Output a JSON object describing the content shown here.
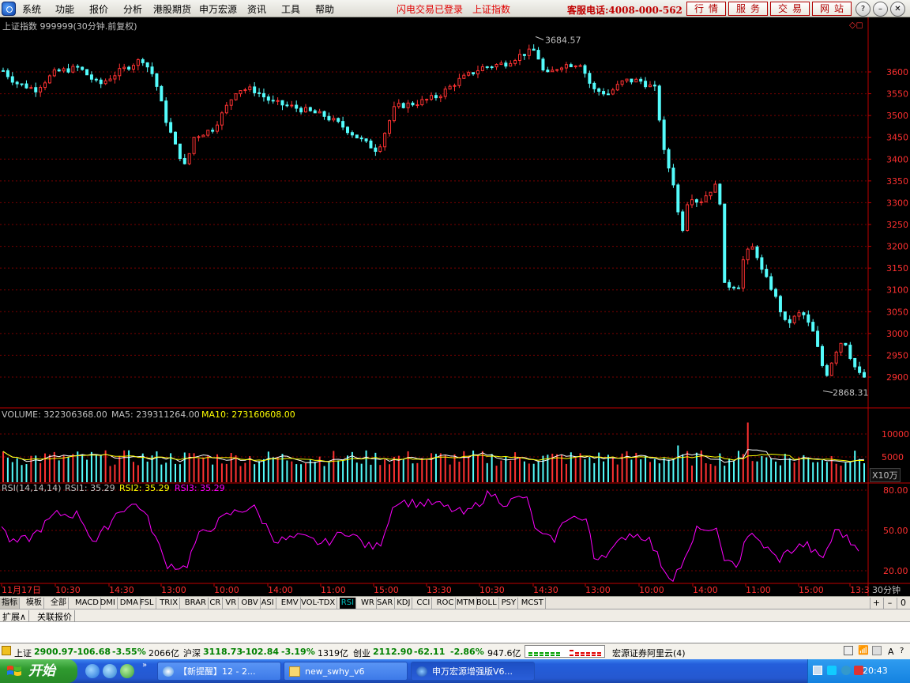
{
  "menu": [
    "系统",
    "功能",
    "报价",
    "分析",
    "港股期货",
    "申万宏源",
    "资讯",
    "工具",
    "帮助"
  ],
  "links": [
    "闪电交易已登录",
    "上证指数"
  ],
  "hotline": "客服电话:4008-000-562",
  "top_buttons": [
    "行情",
    "服务",
    "交易",
    "网站"
  ],
  "window_buttons": {
    "help": "?",
    "minimize": "–",
    "restore": "❐",
    "close": "✕"
  },
  "main_pane": {
    "title": "上证指数 999999(30分钟.前复权)",
    "high_label": "3684.57",
    "low_label": "2868.31",
    "y_ticks": [
      "3600",
      "3550",
      "3500",
      "3450",
      "3400",
      "3350",
      "3300",
      "3250",
      "3200",
      "3150",
      "3100",
      "3050",
      "3000",
      "2950",
      "2900"
    ]
  },
  "volume_pane": {
    "vol_label": "VOLUME: 322306368.00",
    "ma5_label": "MA5: 239311264.00",
    "ma10_label": "MA10: 273160608.00",
    "y_ticks": [
      "10000",
      "5000"
    ],
    "unit": "X10万"
  },
  "rsi_pane": {
    "title": "RSI(14,14,14)",
    "rsi1_label": "RSI1: 35.29",
    "rsi2_label": "RSI2: 35.29",
    "rsi3_label": "RSI3: 35.29",
    "y_ticks": [
      "80.00",
      "50.00",
      "20.00"
    ]
  },
  "time_axis": [
    "11月17日",
    "10:30",
    "14:30",
    "13:00",
    "10:00",
    "14:00",
    "11:00",
    "15:00",
    "13:30",
    "10:30",
    "14:30",
    "13:00",
    "10:00",
    "14:00",
    "11:00",
    "15:00",
    "13:3"
  ],
  "period": "30分钟",
  "indicator_tabs": [
    "指标",
    "模板",
    "全部",
    "MACD",
    "DMI",
    "DMA",
    "FSL",
    "TRIX",
    "BRAR",
    "CR",
    "VR",
    "OBV",
    "ASI",
    "EMV",
    "VOL-TDX",
    "RSI",
    "WR",
    "SAR",
    "KDJ",
    "CCI",
    "ROC",
    "MTM",
    "BOLL",
    "PSY",
    "MCST"
  ],
  "active_indicator": "RSI",
  "strip_controls": [
    "+",
    "–",
    "0"
  ],
  "ext_tabs": [
    "扩展∧",
    "关联报价"
  ],
  "status": {
    "sh_name": "上证",
    "sh_value": "2900.97",
    "sh_change": "-106.68",
    "sh_pct": "-3.55%",
    "sh_amount": "2066亿",
    "hs_name": "沪深",
    "hs_value": "3118.73",
    "hs_change": "-102.84",
    "hs_pct": "-3.19%",
    "hs_amount": "1319亿",
    "cy_name": "创业",
    "cy_value": "2112.90",
    "cy_change": "-62.11",
    "cy_pct": "-2.86%",
    "cy_amount": "947.6亿",
    "broker": "宏源证券阿里云(4)"
  },
  "taskbar": {
    "start": "开始",
    "tasks": [
      "【新提醒】12 - 2...",
      "new_swhy_v6",
      "申万宏源增强版V6..."
    ],
    "clock": "20:43"
  },
  "colors": {
    "up": "#ff3232",
    "down": "#54fcfc",
    "grid": "#7a0000",
    "axis": "#c00000",
    "ma10": "#ffff00",
    "rsi": "#ff00ff",
    "vol_ma": "#ffffff"
  }
}
